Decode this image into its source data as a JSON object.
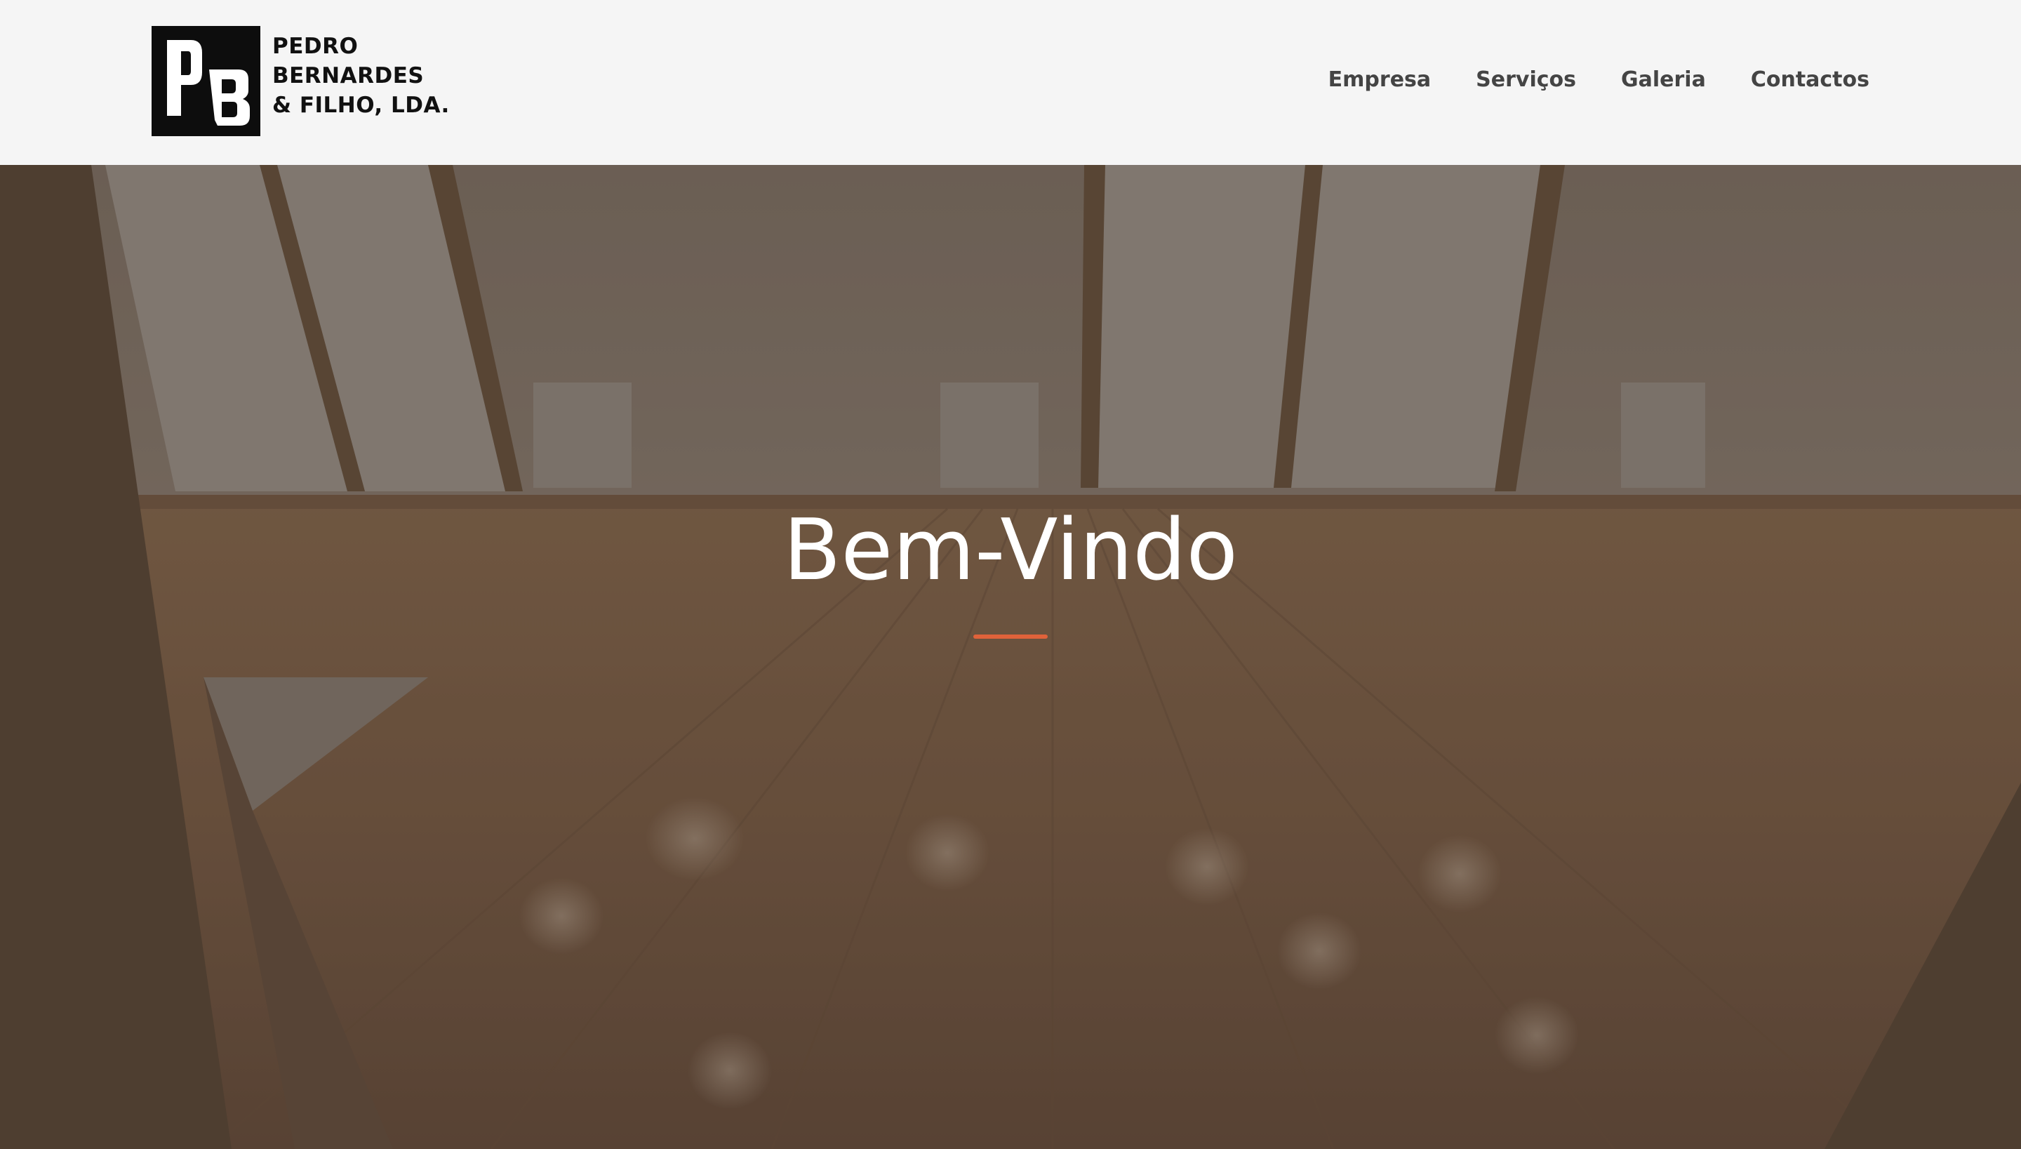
{
  "brand": {
    "monogram_line1": "P",
    "monogram_line2": "B",
    "lines": [
      "PEDRO",
      "BERNARDES",
      "& FILHO, LDA."
    ]
  },
  "nav": {
    "items": [
      {
        "label": "Empresa"
      },
      {
        "label": "Serviços"
      },
      {
        "label": "Galeria"
      },
      {
        "label": "Contactos"
      }
    ]
  },
  "hero": {
    "title": "Bem-Vindo",
    "accent_color": "#e0623a"
  },
  "colors": {
    "header_bg": "#f5f5f5",
    "nav_text": "#444444",
    "logo_black": "#0d0d0d"
  }
}
